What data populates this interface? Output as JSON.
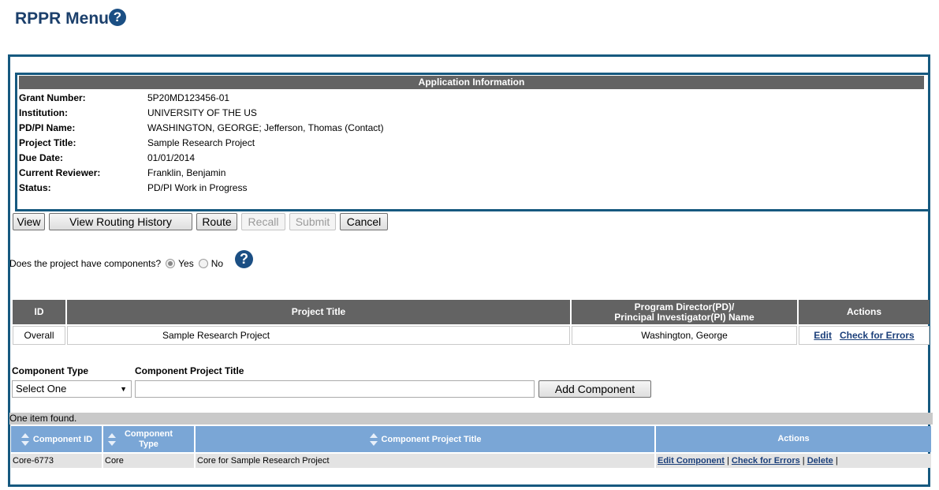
{
  "page": {
    "title": "RPPR Menu",
    "help_glyph": "?"
  },
  "app_info": {
    "header": "Application Information",
    "rows": [
      {
        "label": "Grant Number:",
        "value": "5P20MD123456-01"
      },
      {
        "label": "Institution:",
        "value": "UNIVERSITY OF THE US"
      },
      {
        "label": "PD/PI Name:",
        "value": "WASHINGTON, GEORGE; Jefferson, Thomas (Contact)"
      },
      {
        "label": "Project Title:",
        "value": "Sample Research Project"
      },
      {
        "label": "Due Date:",
        "value": "01/01/2014"
      },
      {
        "label": "Current Reviewer:",
        "value": "Franklin, Benjamin"
      },
      {
        "label": "Status:",
        "value": "PD/PI Work in Progress"
      }
    ]
  },
  "toolbar": {
    "view": "View",
    "view_routing_history": "View Routing History",
    "route": "Route",
    "recall": "Recall",
    "submit": "Submit",
    "cancel": "Cancel"
  },
  "components_question": {
    "text": "Does the project have components?",
    "yes": "Yes",
    "no": "No",
    "selected": "Yes"
  },
  "project_table": {
    "headers": {
      "id": "ID",
      "title": "Project Title",
      "pd_line1": "Program Director(PD)/",
      "pd_line2": "Principal Investigator(PI) Name",
      "actions": "Actions"
    },
    "row": {
      "id": "Overall",
      "title": "Sample Research Project",
      "pd": "Washington, George",
      "edit": "Edit",
      "check": "Check for Errors"
    }
  },
  "add_component": {
    "type_label": "Component Type",
    "title_label": "Component Project Title",
    "type_value": "Select One",
    "title_value": "",
    "button": "Add Component"
  },
  "components_list": {
    "items_found": "One item found.",
    "headers": {
      "id": "Component ID",
      "type_line1": "Component",
      "type_line2": "Type",
      "title": "Component Project Title",
      "actions": "Actions"
    },
    "rows": [
      {
        "id": "Core-6773",
        "type": "Core",
        "title": "Core for Sample Research Project",
        "edit": "Edit Component",
        "check": "Check for Errors",
        "delete": "Delete"
      }
    ],
    "separator": "|"
  }
}
